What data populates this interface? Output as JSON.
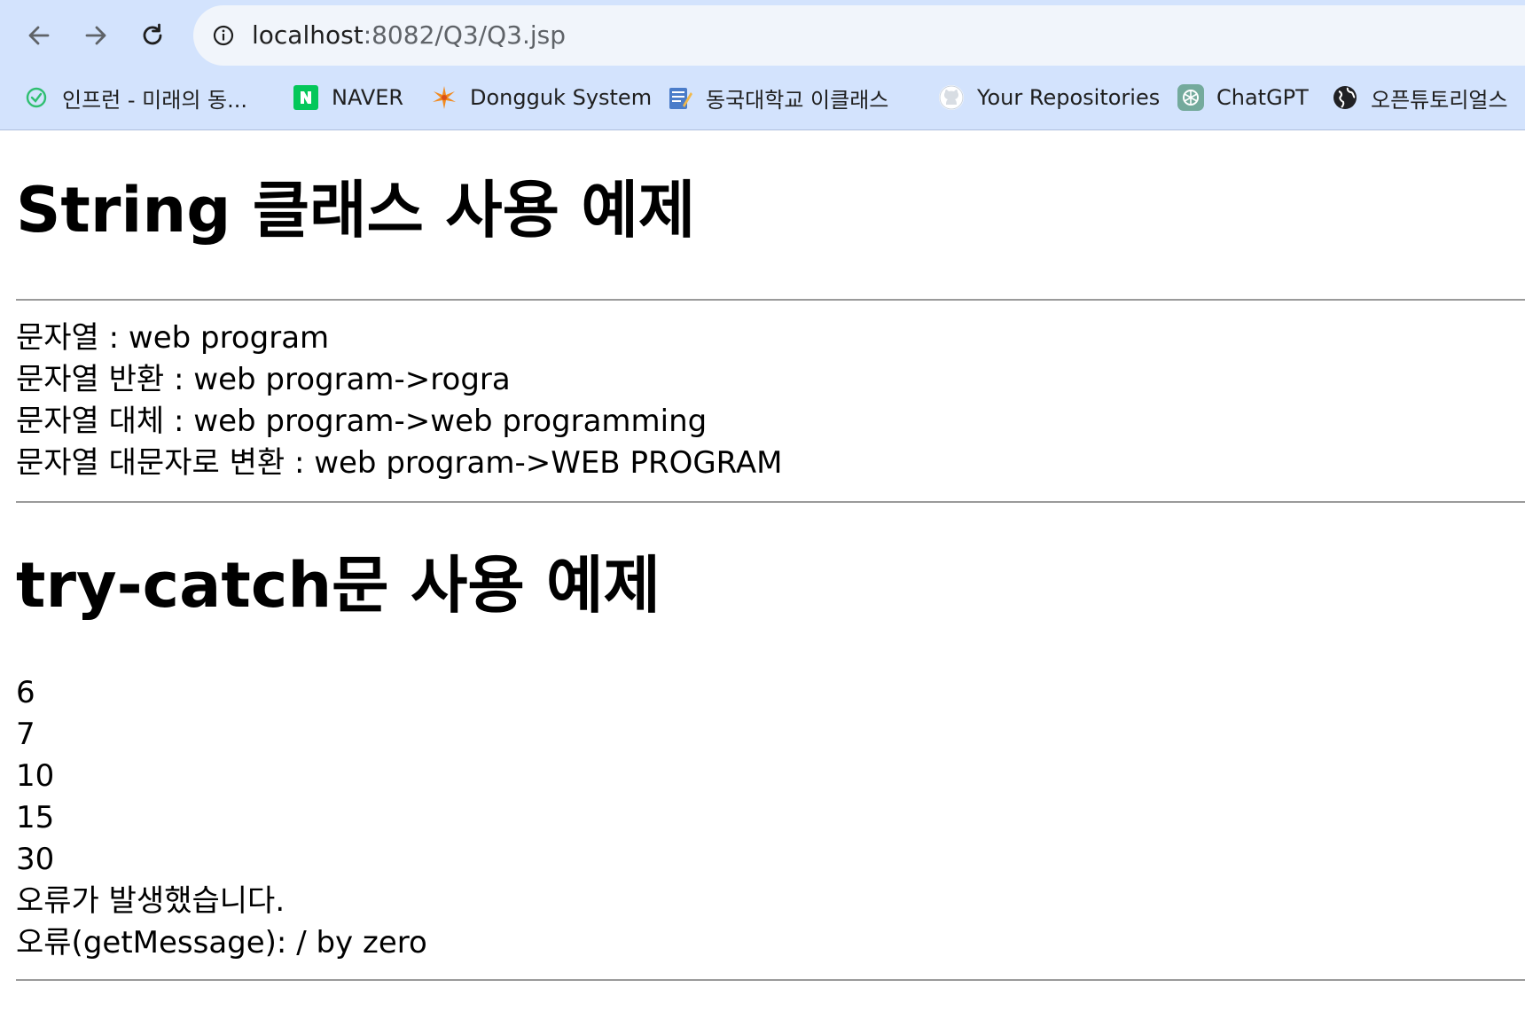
{
  "browser": {
    "url_host": "localhost",
    "url_path": ":8082/Q3/Q3.jsp",
    "bookmarks": [
      {
        "label": "인프런 - 미래의 동...",
        "icon": "inflearn-icon"
      },
      {
        "label": "NAVER",
        "icon": "naver-icon"
      },
      {
        "label": "Dongguk System",
        "icon": "dongguk-icon"
      },
      {
        "label": "동국대학교 이클래스",
        "icon": "eclass-icon"
      },
      {
        "label": "Your Repositories",
        "icon": "github-icon"
      },
      {
        "label": "ChatGPT",
        "icon": "chatgpt-icon"
      },
      {
        "label": "오픈튜토리얼스",
        "icon": "globe-icon"
      }
    ]
  },
  "content": {
    "string_section": {
      "heading": "String 클래스 사용 예제",
      "lines": [
        "문자열 : web program",
        "문자열 반환 : web program->rogra",
        "문자열 대체 : web program->web programming",
        "문자열 대문자로 변환 : web program->WEB PROGRAM"
      ]
    },
    "try_section": {
      "heading": "try-catch문 사용 예제",
      "lines": [
        "6",
        "7",
        "10",
        "15",
        "30",
        "오류가 발생했습니다.",
        "오류(getMessage): / by zero"
      ]
    }
  }
}
